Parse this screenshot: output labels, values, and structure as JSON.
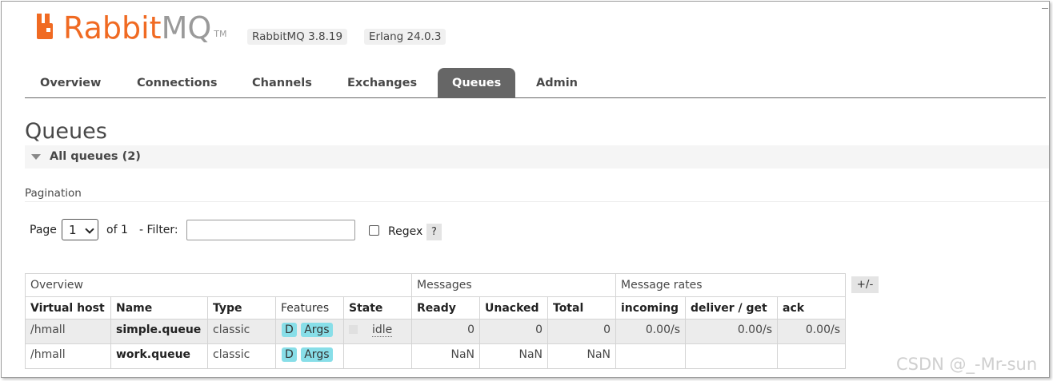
{
  "header": {
    "logo_rabbit": "Rabbit",
    "logo_mq": "MQ",
    "logo_tm": "TM",
    "rabbitmq_version": "RabbitMQ 3.8.19",
    "erlang_version": "Erlang 24.0.3",
    "brand_color": "#f06a22"
  },
  "tabs": [
    {
      "label": "Overview"
    },
    {
      "label": "Connections"
    },
    {
      "label": "Channels"
    },
    {
      "label": "Exchanges"
    },
    {
      "label": "Queues",
      "active": true
    },
    {
      "label": "Admin"
    }
  ],
  "page": {
    "title": "Queues",
    "section_label": "All queues (2)",
    "pagination_label": "Pagination"
  },
  "pagination": {
    "page_label": "Page",
    "page_value": "1",
    "of_label": "of 1",
    "filter_label": "- Filter:",
    "filter_value": "",
    "regex_label": "Regex",
    "help_label": "?"
  },
  "table": {
    "groups": [
      "Overview",
      "Messages",
      "Message rates"
    ],
    "columns": [
      "Virtual host",
      "Name",
      "Type",
      "Features",
      "State",
      "Ready",
      "Unacked",
      "Total",
      "incoming",
      "deliver / get",
      "ack"
    ],
    "toggle_label": "+/-",
    "rows": [
      {
        "vhost": "/hmall",
        "name": "simple.queue",
        "type": "classic",
        "feat1": "D",
        "feat2": "Args",
        "state": "idle",
        "ready": "0",
        "unacked": "0",
        "total": "0",
        "incoming": "0.00/s",
        "deliver": "0.00/s",
        "ack": "0.00/s"
      },
      {
        "vhost": "/hmall",
        "name": "work.queue",
        "type": "classic",
        "feat1": "D",
        "feat2": "Args",
        "state": "",
        "ready": "NaN",
        "unacked": "NaN",
        "total": "NaN",
        "incoming": "",
        "deliver": "",
        "ack": ""
      }
    ]
  },
  "watermark": "CSDN @_-Mr-sun"
}
